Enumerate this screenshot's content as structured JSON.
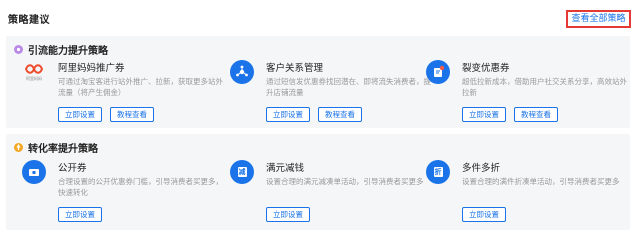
{
  "header": {
    "title": "策略建议",
    "view_all": "查看全部策略"
  },
  "sections": [
    {
      "title": "引流能力提升策略",
      "cards": [
        {
          "title": "阿里妈妈推广券",
          "desc": "可通过淘宝客进行站外推广、拉新，获取更多站外流量（将产生佣金）",
          "btn1": "立即设置",
          "btn2": "教程查看",
          "icon": "alimama-logo-icon",
          "logo_text": "阿里妈妈"
        },
        {
          "title": "客户关系管理",
          "desc": "通过短信发优惠券找回潜在、即将流失消费者，提升店铺流量",
          "btn1": "立即设置",
          "btn2": "教程查看",
          "icon": "crm-icon"
        },
        {
          "title": "裂变优惠券",
          "desc": "超低拉新成本，借助用户社交关系分享，高效站外拉新",
          "btn1": "立即设置",
          "btn2": "教程查看",
          "icon": "fission-coupon-icon"
        }
      ]
    },
    {
      "title": "转化率提升策略",
      "cards": [
        {
          "title": "公开券",
          "desc": "合理设置的公开优惠券门槛，引导消费者买更多，快速转化",
          "btn1": "立即设置",
          "icon": "public-coupon-icon"
        },
        {
          "title": "满元减钱",
          "desc": "设置合理的满元减凑单活动，引导消费者买更多",
          "btn1": "立即设置",
          "icon": "full-reduction-icon",
          "glyph": "减"
        },
        {
          "title": "多件多折",
          "desc": "设置合理的满件折凑单活动，引导消费者买更多",
          "btn1": "立即设置",
          "icon": "multi-discount-icon",
          "glyph": "折"
        }
      ]
    }
  ],
  "colors": {
    "accent": "#1a73e8",
    "highlight_box": "#e53935",
    "section_bg": "#f5f6f8"
  }
}
